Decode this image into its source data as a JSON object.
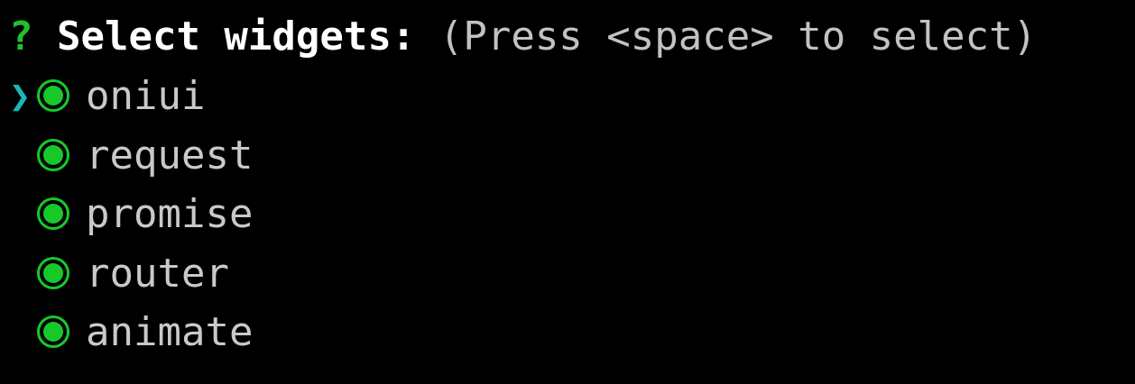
{
  "prompt": {
    "symbol": "?",
    "question": "Select widgets:",
    "hint": "(Press <space> to select)"
  },
  "cursor": {
    "glyph": "❯",
    "active_index": 0
  },
  "choices": [
    {
      "label": "oniui",
      "checked": true
    },
    {
      "label": "request",
      "checked": true
    },
    {
      "label": "promise",
      "checked": true
    },
    {
      "label": "router",
      "checked": true
    },
    {
      "label": "animate",
      "checked": true
    }
  ],
  "colors": {
    "background": "#000000",
    "prompt_symbol": "#1fbf2d",
    "question_text": "#ffffff",
    "hint_text": "#c2c2c2",
    "cursor": "#1bb5b5",
    "radio_checked": "#17c928",
    "choice_text": "#c9c9c9"
  },
  "icons": {
    "cursor": "chevron-right-icon",
    "checked": "radio-checked-icon"
  }
}
